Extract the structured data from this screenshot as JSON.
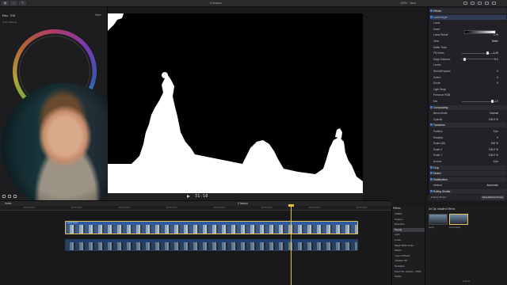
{
  "menubar": {
    "center_label": "0 lesson",
    "zoom": "100%",
    "view_label": "View"
  },
  "left_panel": {
    "title": "Rec. 709",
    "subtitle": "Color Wheels",
    "view_label": "View"
  },
  "viewer": {
    "timecode": "31:18"
  },
  "inspector": {
    "rows": [
      {
        "label": "Effects",
        "type": "section"
      },
      {
        "label": "Luma Keyer",
        "type": "hl"
      },
      {
        "label": "Luma",
        "type": "row"
      },
      {
        "label": "Invert",
        "type": "row"
      },
      {
        "label": "Luma Rolloff",
        "value": "0 %",
        "type": "row"
      },
      {
        "label": "View",
        "value": "Matte",
        "type": "row"
      },
      {
        "label": "Matte Tools",
        "type": "row"
      },
      {
        "label": "Fill Holes",
        "value": "1.49",
        "type": "slider",
        "knob": 0.8
      },
      {
        "label": "Edge Distance",
        "value": "5.0",
        "type": "slider",
        "knob": 0.05
      },
      {
        "label": "Levels",
        "type": "row"
      },
      {
        "label": "Shrink/Expand",
        "value": "0",
        "type": "row"
      },
      {
        "label": "Soften",
        "value": "0",
        "type": "row"
      },
      {
        "label": "Erode",
        "value": "0",
        "type": "row"
      },
      {
        "label": "Light Wrap",
        "type": "row"
      },
      {
        "label": "Preserve RGB",
        "type": "row"
      },
      {
        "label": "Mix",
        "value": "1.0",
        "type": "slider",
        "knob": 0.95
      },
      {
        "label": "Compositing",
        "type": "section"
      },
      {
        "label": "Blend Mode",
        "value": "Normal",
        "type": "row"
      },
      {
        "label": "Opacity",
        "value": "100.0 %",
        "type": "row"
      },
      {
        "label": "Transform",
        "type": "section"
      },
      {
        "label": "Position",
        "value": "0 px",
        "type": "row"
      },
      {
        "label": "Rotation",
        "value": "0",
        "type": "row"
      },
      {
        "label": "Scale (All)",
        "value": "100 %",
        "type": "row"
      },
      {
        "label": "Scale X",
        "value": "100.0 %",
        "type": "row"
      },
      {
        "label": "Scale Y",
        "value": "100.0 %",
        "type": "row"
      },
      {
        "label": "Anchor",
        "value": "0 px",
        "type": "row"
      },
      {
        "label": "Crop",
        "type": "section"
      },
      {
        "label": "Distort",
        "type": "section"
      },
      {
        "label": "Stabilization",
        "type": "section"
      },
      {
        "label": "Method",
        "value": "Automatic",
        "type": "row"
      },
      {
        "label": "Rolling Shutter",
        "type": "section"
      }
    ],
    "footer_left": "Rolling Shutter",
    "save_label": "Save Effects Preset"
  },
  "timeline": {
    "index_label": "Index",
    "project_label": "0 lesson",
    "ruler": [
      "00:00:00:00",
      "00:00:05:00",
      "00:00:10:00",
      "00:00:15:00",
      "00:00:20:00",
      "00:00:25:00",
      "00:00:30:00",
      "00:00:35:00"
    ],
    "clip_top_name": "Luma Keyer",
    "playhead_progress": 0.74
  },
  "effects_browser": {
    "title": "Effects",
    "items": [
      "VIDEO",
      "Custom",
      "Distortion",
      "Keying",
      "Light",
      "Looks",
      "Magic Bullet Suite",
      "Masks",
      "m-gen Diffuser",
      "mFlatten 3D",
      "Nostalgia",
      "Pixel Film Studios - PXPL",
      "Stylize"
    ],
    "selected": "Keying"
  },
  "fx_grid": {
    "header": "All Clip      Installed Effects",
    "thumbs": [
      {
        "label": "Keyer"
      },
      {
        "label": "Luma Keyer"
      }
    ],
    "count": "2 items"
  }
}
